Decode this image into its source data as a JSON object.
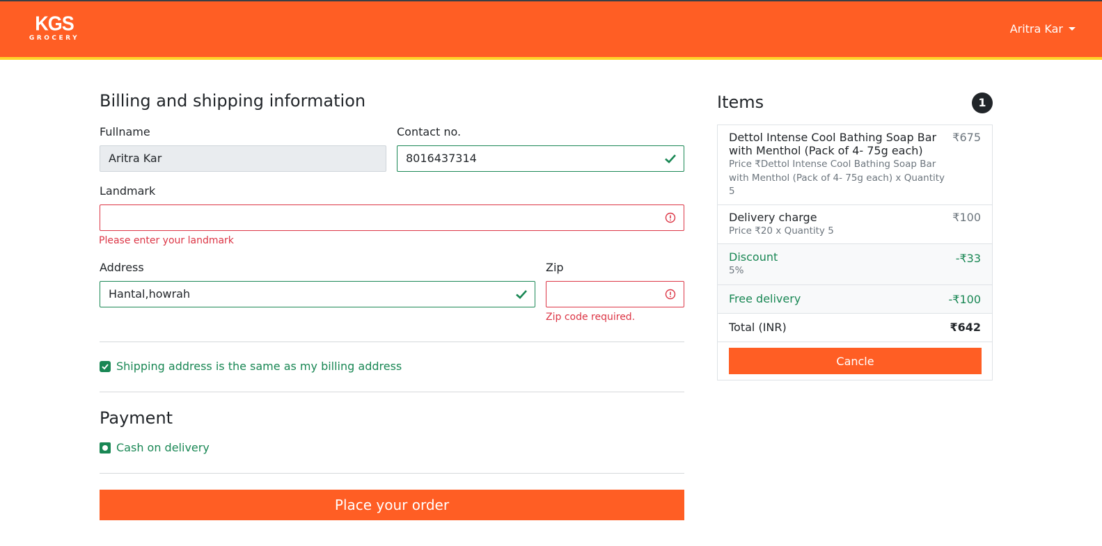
{
  "header": {
    "logo_main": "KGS",
    "logo_sub": "GROCERY",
    "user_name": "Aritra Kar"
  },
  "billing": {
    "title": "Billing and shipping information",
    "fullname_label": "Fullname",
    "fullname_value": "Aritra Kar",
    "contact_label": "Contact no.",
    "contact_value": "8016437314",
    "landmark_label": "Landmark",
    "landmark_value": "",
    "landmark_error": "Please enter your landmark",
    "address_label": "Address",
    "address_value": "Hantal,howrah",
    "zip_label": "Zip",
    "zip_value": "",
    "zip_error": "Zip code required.",
    "same_address_label": "Shipping address is the same as my billing address"
  },
  "payment": {
    "title": "Payment",
    "method_label": "Cash on delivery",
    "place_order_label": "Place your order"
  },
  "cart": {
    "title": "Items",
    "count": "1",
    "items": [
      {
        "name": "Dettol Intense Cool Bathing Soap Bar with Menthol (Pack of 4- 75g each)",
        "detail": "Price ₹Dettol Intense Cool Bathing Soap Bar with Menthol (Pack of 4- 75g each) x Quantity 5",
        "price": "₹675"
      }
    ],
    "delivery": {
      "name": "Delivery charge",
      "detail": "Price ₹20 x Quantity 5",
      "price": "₹100"
    },
    "discount": {
      "name": "Discount",
      "detail": "5%",
      "price": "-₹33"
    },
    "free_delivery": {
      "name": "Free delivery",
      "price": "-₹100"
    },
    "total": {
      "label": "Total (INR)",
      "value": "₹642"
    },
    "cancel_label": "Cancle"
  },
  "colors": {
    "brand": "#ff5e24",
    "accent_line": "#ffd32a",
    "valid": "#198754",
    "invalid": "#dc3545"
  }
}
